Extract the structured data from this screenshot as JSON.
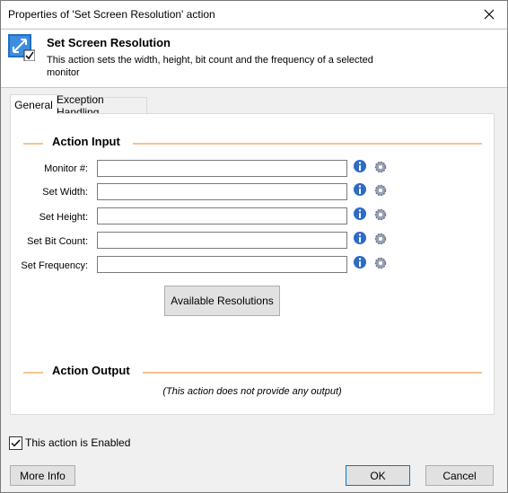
{
  "window": {
    "title": "Properties of 'Set Screen Resolution' action"
  },
  "header": {
    "title": "Set Screen Resolution",
    "description": "This action sets the width, height, bit count and the frequency of a selected monitor",
    "icon": "screen-resolution-icon"
  },
  "tabs": [
    {
      "label": "General",
      "selected": true
    },
    {
      "label": "Exception Handling",
      "selected": false
    }
  ],
  "action_input": {
    "title": "Action Input",
    "fields": [
      {
        "label": "Monitor #:",
        "value": ""
      },
      {
        "label": "Set Width:",
        "value": ""
      },
      {
        "label": "Set Height:",
        "value": ""
      },
      {
        "label": "Set Bit Count:",
        "value": ""
      },
      {
        "label": "Set Frequency:",
        "value": ""
      }
    ],
    "available_button": "Available Resolutions"
  },
  "action_output": {
    "title": "Action Output",
    "note": "(This action does not provide any output)"
  },
  "enabled": {
    "label": "This action is Enabled",
    "checked": true
  },
  "footer": {
    "more_info": "More Info",
    "ok": "OK",
    "cancel": "Cancel"
  },
  "colors": {
    "section_line": "#f5c28f",
    "ok_border": "#0078d7"
  }
}
